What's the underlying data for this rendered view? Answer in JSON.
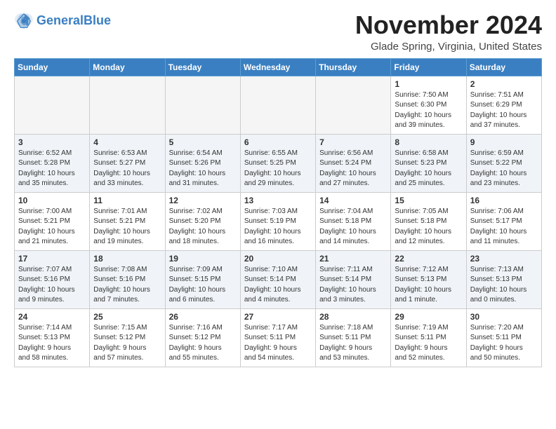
{
  "header": {
    "logo_line1": "General",
    "logo_line2": "Blue",
    "month": "November 2024",
    "location": "Glade Spring, Virginia, United States"
  },
  "weekdays": [
    "Sunday",
    "Monday",
    "Tuesday",
    "Wednesday",
    "Thursday",
    "Friday",
    "Saturday"
  ],
  "weeks": [
    [
      {
        "day": "",
        "info": ""
      },
      {
        "day": "",
        "info": ""
      },
      {
        "day": "",
        "info": ""
      },
      {
        "day": "",
        "info": ""
      },
      {
        "day": "",
        "info": ""
      },
      {
        "day": "1",
        "info": "Sunrise: 7:50 AM\nSunset: 6:30 PM\nDaylight: 10 hours\nand 39 minutes."
      },
      {
        "day": "2",
        "info": "Sunrise: 7:51 AM\nSunset: 6:29 PM\nDaylight: 10 hours\nand 37 minutes."
      }
    ],
    [
      {
        "day": "3",
        "info": "Sunrise: 6:52 AM\nSunset: 5:28 PM\nDaylight: 10 hours\nand 35 minutes."
      },
      {
        "day": "4",
        "info": "Sunrise: 6:53 AM\nSunset: 5:27 PM\nDaylight: 10 hours\nand 33 minutes."
      },
      {
        "day": "5",
        "info": "Sunrise: 6:54 AM\nSunset: 5:26 PM\nDaylight: 10 hours\nand 31 minutes."
      },
      {
        "day": "6",
        "info": "Sunrise: 6:55 AM\nSunset: 5:25 PM\nDaylight: 10 hours\nand 29 minutes."
      },
      {
        "day": "7",
        "info": "Sunrise: 6:56 AM\nSunset: 5:24 PM\nDaylight: 10 hours\nand 27 minutes."
      },
      {
        "day": "8",
        "info": "Sunrise: 6:58 AM\nSunset: 5:23 PM\nDaylight: 10 hours\nand 25 minutes."
      },
      {
        "day": "9",
        "info": "Sunrise: 6:59 AM\nSunset: 5:22 PM\nDaylight: 10 hours\nand 23 minutes."
      }
    ],
    [
      {
        "day": "10",
        "info": "Sunrise: 7:00 AM\nSunset: 5:21 PM\nDaylight: 10 hours\nand 21 minutes."
      },
      {
        "day": "11",
        "info": "Sunrise: 7:01 AM\nSunset: 5:21 PM\nDaylight: 10 hours\nand 19 minutes."
      },
      {
        "day": "12",
        "info": "Sunrise: 7:02 AM\nSunset: 5:20 PM\nDaylight: 10 hours\nand 18 minutes."
      },
      {
        "day": "13",
        "info": "Sunrise: 7:03 AM\nSunset: 5:19 PM\nDaylight: 10 hours\nand 16 minutes."
      },
      {
        "day": "14",
        "info": "Sunrise: 7:04 AM\nSunset: 5:18 PM\nDaylight: 10 hours\nand 14 minutes."
      },
      {
        "day": "15",
        "info": "Sunrise: 7:05 AM\nSunset: 5:18 PM\nDaylight: 10 hours\nand 12 minutes."
      },
      {
        "day": "16",
        "info": "Sunrise: 7:06 AM\nSunset: 5:17 PM\nDaylight: 10 hours\nand 11 minutes."
      }
    ],
    [
      {
        "day": "17",
        "info": "Sunrise: 7:07 AM\nSunset: 5:16 PM\nDaylight: 10 hours\nand 9 minutes."
      },
      {
        "day": "18",
        "info": "Sunrise: 7:08 AM\nSunset: 5:16 PM\nDaylight: 10 hours\nand 7 minutes."
      },
      {
        "day": "19",
        "info": "Sunrise: 7:09 AM\nSunset: 5:15 PM\nDaylight: 10 hours\nand 6 minutes."
      },
      {
        "day": "20",
        "info": "Sunrise: 7:10 AM\nSunset: 5:14 PM\nDaylight: 10 hours\nand 4 minutes."
      },
      {
        "day": "21",
        "info": "Sunrise: 7:11 AM\nSunset: 5:14 PM\nDaylight: 10 hours\nand 3 minutes."
      },
      {
        "day": "22",
        "info": "Sunrise: 7:12 AM\nSunset: 5:13 PM\nDaylight: 10 hours\nand 1 minute."
      },
      {
        "day": "23",
        "info": "Sunrise: 7:13 AM\nSunset: 5:13 PM\nDaylight: 10 hours\nand 0 minutes."
      }
    ],
    [
      {
        "day": "24",
        "info": "Sunrise: 7:14 AM\nSunset: 5:13 PM\nDaylight: 9 hours\nand 58 minutes."
      },
      {
        "day": "25",
        "info": "Sunrise: 7:15 AM\nSunset: 5:12 PM\nDaylight: 9 hours\nand 57 minutes."
      },
      {
        "day": "26",
        "info": "Sunrise: 7:16 AM\nSunset: 5:12 PM\nDaylight: 9 hours\nand 55 minutes."
      },
      {
        "day": "27",
        "info": "Sunrise: 7:17 AM\nSunset: 5:11 PM\nDaylight: 9 hours\nand 54 minutes."
      },
      {
        "day": "28",
        "info": "Sunrise: 7:18 AM\nSunset: 5:11 PM\nDaylight: 9 hours\nand 53 minutes."
      },
      {
        "day": "29",
        "info": "Sunrise: 7:19 AM\nSunset: 5:11 PM\nDaylight: 9 hours\nand 52 minutes."
      },
      {
        "day": "30",
        "info": "Sunrise: 7:20 AM\nSunset: 5:11 PM\nDaylight: 9 hours\nand 50 minutes."
      }
    ]
  ]
}
